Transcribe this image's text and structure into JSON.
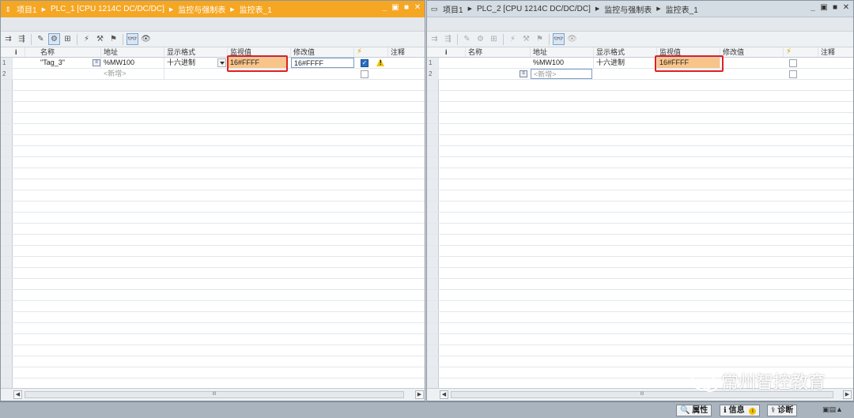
{
  "left_panel": {
    "breadcrumbs": [
      "项目1",
      "PLC_1 [CPU 1214C DC/DC/DC]",
      "监控与强制表",
      "监控表_1"
    ],
    "columns": [
      "i",
      "名称",
      "地址",
      "显示格式",
      "监视值",
      "修改值",
      "",
      "注释"
    ],
    "rows": [
      {
        "num": "1",
        "name": "\"Tag_3\"",
        "address": "%MW100",
        "format": "十六进制",
        "monitor": "16#FFFF",
        "modify": "16#FFFF",
        "checked": true,
        "warning": true
      },
      {
        "num": "2",
        "name": "",
        "address": "<新增>",
        "format": "",
        "monitor": "",
        "modify": "",
        "checked": false,
        "warning": false
      }
    ],
    "scroll_thumb": "III"
  },
  "right_panel": {
    "breadcrumbs": [
      "项目1",
      "PLC_2 [CPU 1214C DC/DC/DC]",
      "监控与强制表",
      "监控表_1"
    ],
    "columns": [
      "i",
      "名称",
      "地址",
      "显示格式",
      "监视值",
      "修改值",
      "",
      "注释"
    ],
    "rows": [
      {
        "num": "1",
        "name": "",
        "address": "%MW100",
        "format": "十六进制",
        "monitor": "16#FFFF",
        "modify": ""
      },
      {
        "num": "2",
        "name": "",
        "address": "<新增>",
        "format": "",
        "monitor": "",
        "modify": ""
      }
    ],
    "scroll_thumb": "III"
  },
  "statusbar": {
    "properties": "属性",
    "info": "信息",
    "info_badge": "i",
    "diagnostics": "诊断"
  },
  "watermark": {
    "text": "常州智控教育"
  },
  "colors": {
    "title_active": "#f5a623",
    "monitor_highlight": "#f7c58a",
    "red_box": "#e02020"
  }
}
